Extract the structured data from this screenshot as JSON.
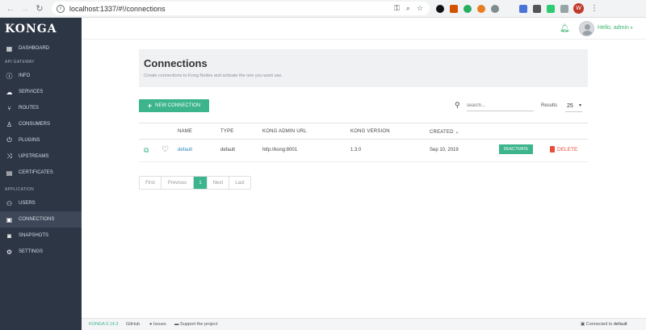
{
  "browser": {
    "url": "localhost:1337/#!/connections",
    "profile_initial": "W"
  },
  "sidebar": {
    "logo": "KONGA",
    "dashboard": "DASHBOARD",
    "section_api": "API GATEWAY",
    "items_api": [
      "INFO",
      "SERVICES",
      "ROUTES",
      "CONSUMERS",
      "PLUGINS",
      "UPSTREAMS",
      "CERTIFICATES"
    ],
    "section_app": "APPLICATION",
    "items_app": [
      "USERS",
      "CONNECTIONS",
      "SNAPSHOTS",
      "SETTINGS"
    ],
    "active": "CONNECTIONS"
  },
  "topbar": {
    "greeting": "Hello, admin"
  },
  "page": {
    "title": "Connections",
    "subtitle": "Create connections to Kong Nodes and activate the one you want use.",
    "new_button": "NEW CONNECTION",
    "search_placeholder": "search...",
    "results_label": "Results",
    "results_value": "25"
  },
  "table": {
    "headers": {
      "name": "NAME",
      "type": "TYPE",
      "url": "KONG ADMIN URL",
      "version": "KONG VERSION",
      "created": "CREATED"
    },
    "rows": [
      {
        "name": "default",
        "type": "default",
        "url": "http://kong:8001",
        "version": "1.3.0",
        "created": "Sep 10, 2019",
        "action": "DEACTIVATE",
        "delete": "DELETE"
      }
    ]
  },
  "pagination": [
    "First",
    "Previous",
    "1",
    "Next",
    "Last"
  ],
  "footer": {
    "version": "KONGA 0.14.3",
    "github": "GitHub",
    "issues": "Issues",
    "support": "Support the project",
    "connected_prefix": "Connected to",
    "connected_name": "default"
  },
  "colors": {
    "sidebar_bg": "#2c3645",
    "accent_green": "#3cb48c",
    "link_blue": "#2e86c1",
    "delete_red": "#e74c3c"
  }
}
